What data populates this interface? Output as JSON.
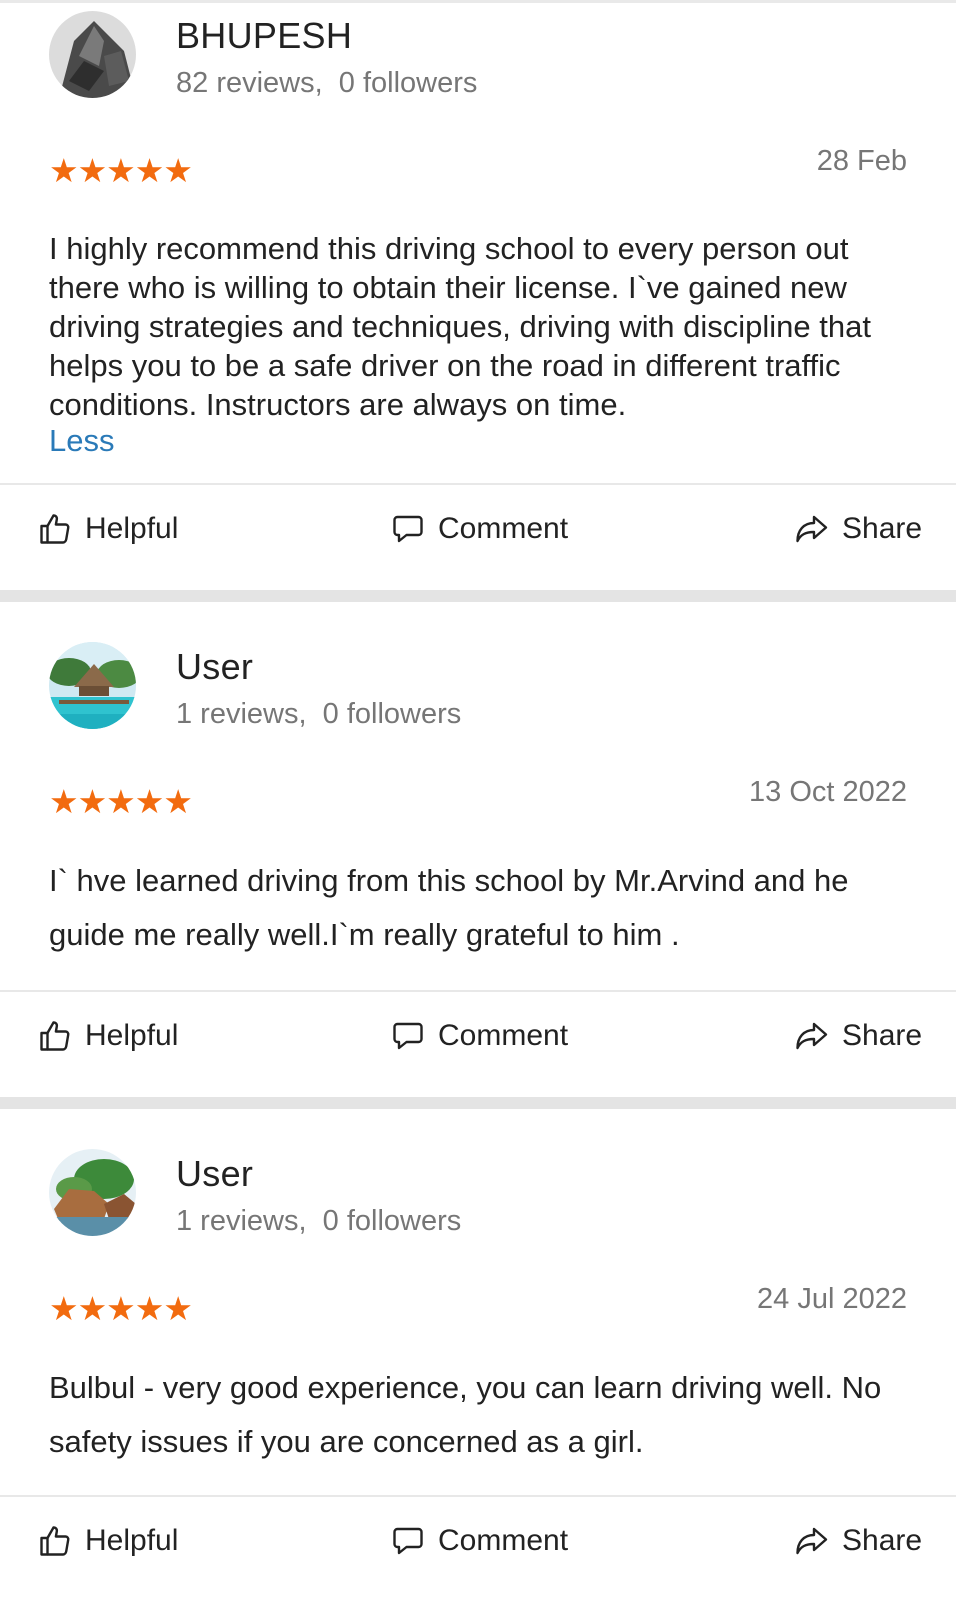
{
  "reviews": [
    {
      "user_name": "BHUPESH",
      "user_stats": "82 reviews,  0 followers",
      "rating": "★★★★★",
      "date": "28 Feb",
      "text": "I highly recommend this driving school to every person out there who is willing to obtain their license. I`ve gained new driving strategies and techniques, driving with discipline that helps you to be a safe driver on the road in different traffic conditions. Instructors are always on time.",
      "less_label": "Less",
      "actions": {
        "helpful": "Helpful",
        "comment": "Comment",
        "share": "Share"
      }
    },
    {
      "user_name": "User",
      "user_stats": "1 reviews,  0 followers",
      "rating": "★★★★★",
      "date": "13 Oct 2022",
      "text": "I` hve learned driving from this school by Mr.Arvind and he guide me really well.I`m really grateful to him .",
      "actions": {
        "helpful": "Helpful",
        "comment": "Comment",
        "share": "Share"
      }
    },
    {
      "user_name": "User",
      "user_stats": "1 reviews,  0 followers",
      "rating": "★★★★★",
      "date": "24 Jul 2022",
      "text": "Bulbul - very good experience, you can learn driving well. No safety issues if you are concerned as a girl.",
      "actions": {
        "helpful": "Helpful",
        "comment": "Comment",
        "share": "Share"
      }
    }
  ],
  "colors": {
    "star": "#f26b0f",
    "link": "#2a7ab8",
    "muted_text": "#767676"
  }
}
